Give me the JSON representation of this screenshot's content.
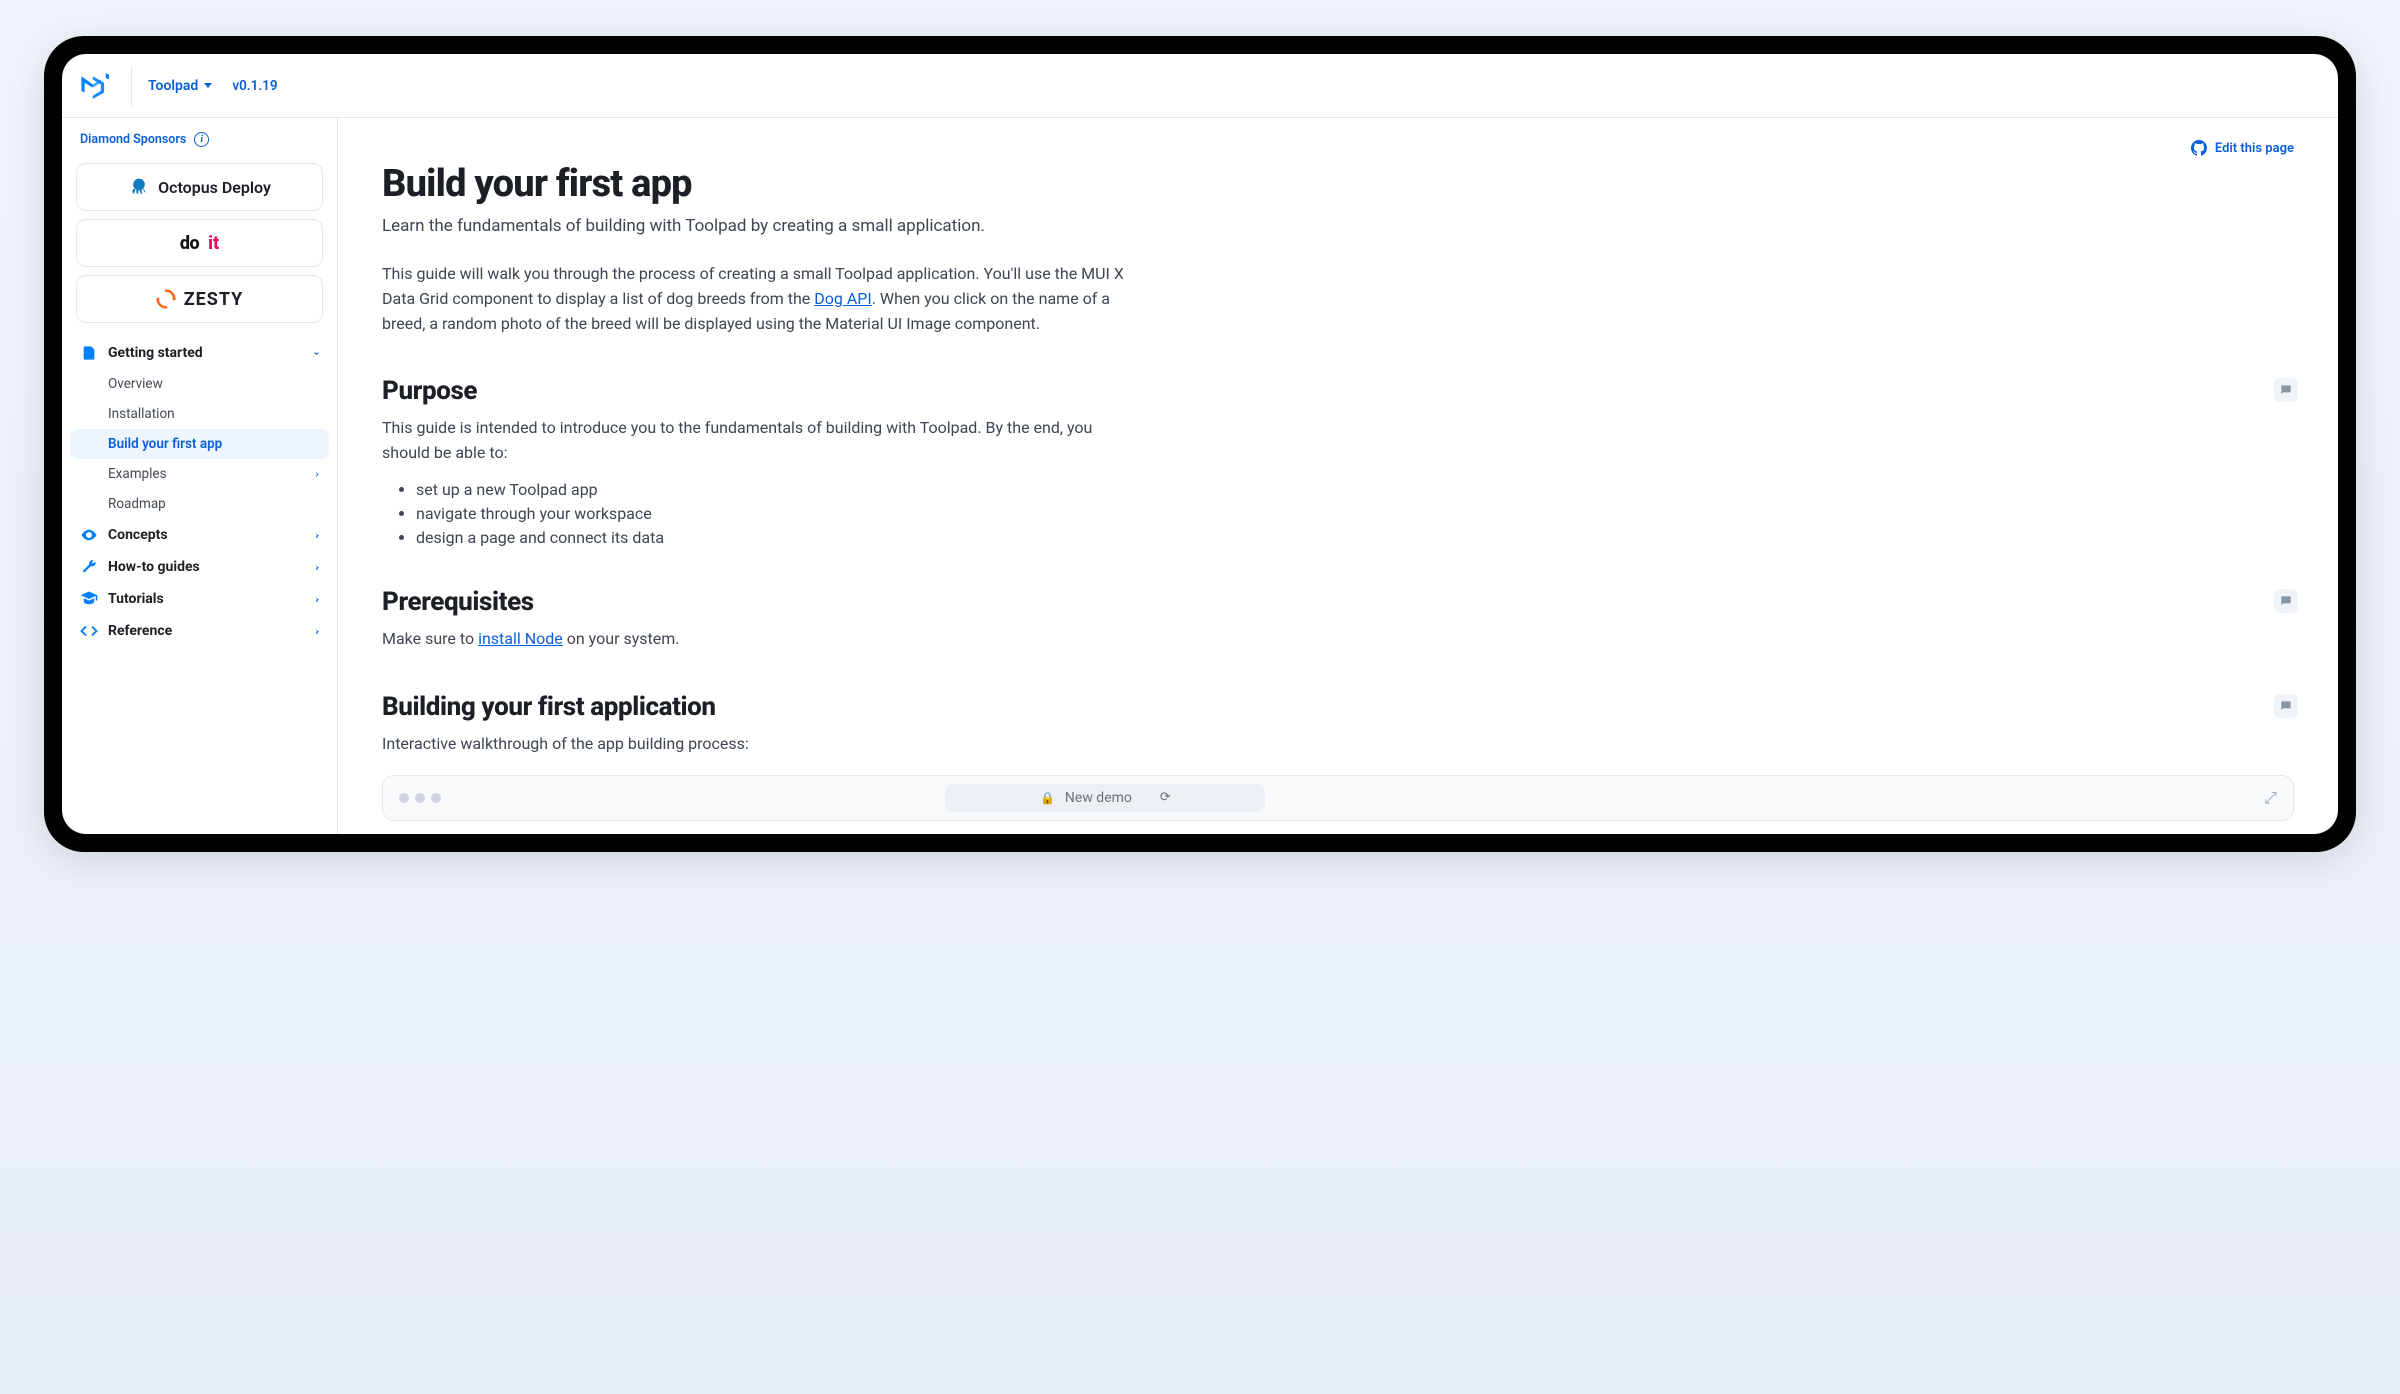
{
  "header": {
    "product": "Toolpad",
    "version": "v0.1.19"
  },
  "sidebar": {
    "sponsors_label": "Diamond Sponsors",
    "sponsors": [
      {
        "name": "Octopus Deploy"
      },
      {
        "name_a": "do",
        "name_b": "it"
      },
      {
        "name": "zesty"
      }
    ],
    "nav": [
      {
        "label": "Getting started",
        "open": true,
        "children": [
          {
            "label": "Overview"
          },
          {
            "label": "Installation"
          },
          {
            "label": "Build your first app",
            "active": true
          },
          {
            "label": "Examples",
            "has_children": true
          },
          {
            "label": "Roadmap"
          }
        ]
      },
      {
        "label": "Concepts"
      },
      {
        "label": "How-to guides"
      },
      {
        "label": "Tutorials"
      },
      {
        "label": "Reference"
      }
    ]
  },
  "main": {
    "edit_label": "Edit this page",
    "title": "Build your first app",
    "subtitle": "Learn the fundamentals of building with Toolpad by creating a small application.",
    "intro_a": "This guide will walk you through the process of creating a small Toolpad application. You'll use the MUI X Data Grid component to display a list of dog breeds from the ",
    "intro_link": "Dog API",
    "intro_b": ". When you click on the name of a breed, a random photo of the breed will be displayed using the Material UI Image component.",
    "purpose_heading": "Purpose",
    "purpose_text": "This guide is intended to introduce you to the fundamentals of building with Toolpad. By the end, you should be able to:",
    "purpose_bullets": [
      "set up a new Toolpad app",
      "navigate through your workspace",
      "design a page and connect its data"
    ],
    "prereq_heading": "Prerequisites",
    "prereq_a": "Make sure to ",
    "prereq_link": "install Node",
    "prereq_b": " on your system.",
    "building_heading": "Building your first application",
    "building_text": "Interactive walkthrough of the app building process:",
    "demo_label": "New demo"
  }
}
